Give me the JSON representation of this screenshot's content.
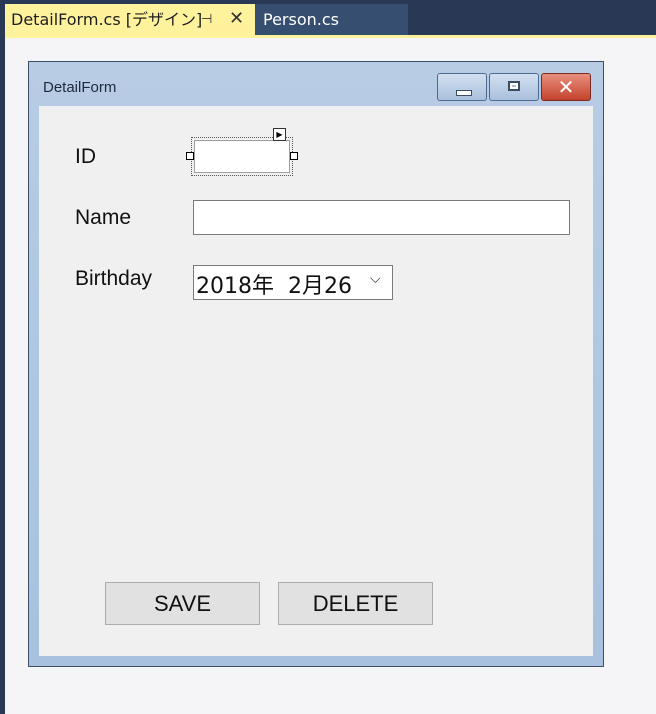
{
  "ide": {
    "tabs": [
      {
        "label": "DetailForm.cs [デザイン]",
        "active": true,
        "pin_glyph": "⊣",
        "close_glyph": "✕"
      },
      {
        "label": "Person.cs",
        "active": false
      }
    ]
  },
  "form": {
    "title": "DetailForm",
    "caption_buttons": {
      "minimize": "minimize-icon",
      "maximize": "maximize-icon",
      "close_glyph": "✕"
    },
    "fields": {
      "id_label": "ID",
      "id_value": "",
      "name_label": "Name",
      "name_value": "",
      "birthday_label": "Birthday",
      "birthday_value": "2018年  2月26",
      "dropdown_caret": "⌵"
    },
    "buttons": {
      "save": "SAVE",
      "delete": "DELETE"
    },
    "smart_tag_glyph": "▶"
  },
  "colors": {
    "active_tab": "#fff29d",
    "tab_strip": "#293955",
    "inactive_tab": "#364e6f",
    "form_frame": "#a7c1de",
    "client_bg": "#f0f0f0",
    "close_button": "#c3432c"
  }
}
